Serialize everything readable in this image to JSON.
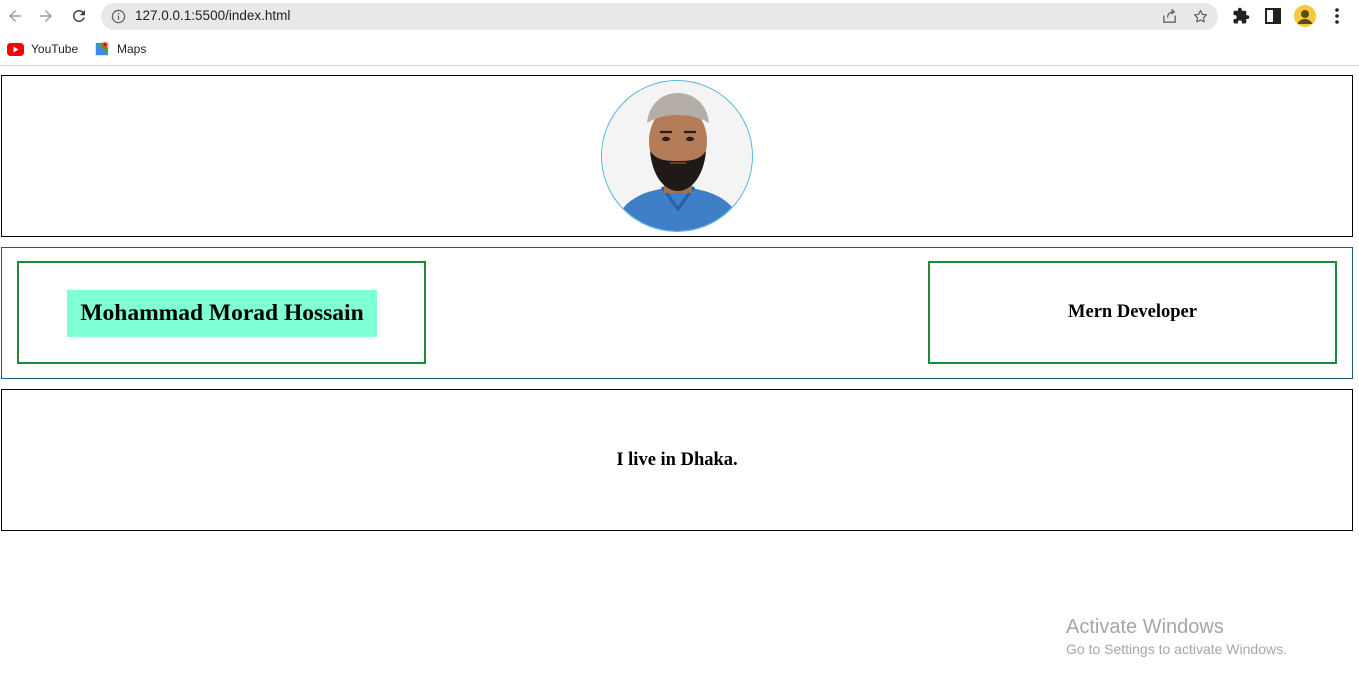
{
  "browser": {
    "url": "127.0.0.1:5500/index.html",
    "bookmarks": [
      {
        "label": "YouTube",
        "icon": "youtube-icon"
      },
      {
        "label": "Maps",
        "icon": "maps-icon"
      }
    ],
    "avatar_color": "#f6c93a"
  },
  "profile": {
    "photo_icon": "profile-photo",
    "name": "Mohammad Morad Hossain",
    "name_bg": "#7fffd4",
    "role": "Mern Developer",
    "location": "I live in Dhaka.",
    "box_border_color": "#1a8a3c"
  },
  "watermark": {
    "title": "Activate Windows",
    "subtitle": "Go to Settings to activate Windows."
  }
}
